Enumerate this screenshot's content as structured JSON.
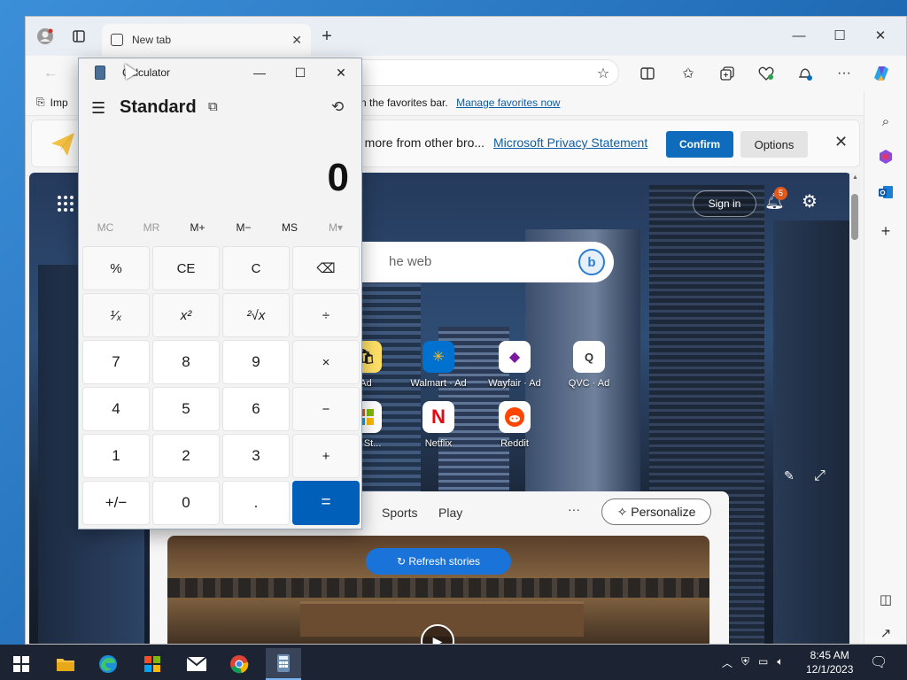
{
  "edge": {
    "tab_label": "New tab",
    "new_tab_icon": "+",
    "favorites_bar": {
      "import_label": "Imp",
      "text": "n the favorites bar.",
      "link": "Manage favorites now"
    },
    "privacy_banner": {
      "text": "d more from other bro...",
      "link": "Microsoft Privacy Statement",
      "confirm": "Confirm",
      "options": "Options"
    },
    "ntp": {
      "sign_in": "Sign in",
      "notification_count": "5",
      "search_placeholder": "he web",
      "tiles": [
        {
          "label": "Ad",
          "icon": "shopping-bag-icon"
        },
        {
          "label": "Walmart · Ad",
          "icon": "walmart-icon"
        },
        {
          "label": "Wayfair · Ad",
          "icon": "wayfair-icon"
        },
        {
          "label": "QVC · Ad",
          "icon": "qvc-icon"
        },
        {
          "label": "oft St...",
          "icon": "microsoft-store-icon"
        },
        {
          "label": "Netflix",
          "icon": "netflix-icon"
        },
        {
          "label": "Reddit",
          "icon": "reddit-icon"
        }
      ],
      "feed": {
        "tabs": [
          "Sports",
          "Play"
        ],
        "more": "···",
        "personalize": "Personalize",
        "refresh": "Refresh stories"
      }
    }
  },
  "calculator": {
    "title": "Calculator",
    "mode": "Standard",
    "display": "0",
    "memory_buttons": [
      {
        "label": "MC",
        "enabled": false
      },
      {
        "label": "MR",
        "enabled": false
      },
      {
        "label": "M+",
        "enabled": true
      },
      {
        "label": "M−",
        "enabled": true
      },
      {
        "label": "MS",
        "enabled": true
      },
      {
        "label": "M▾",
        "enabled": false
      }
    ],
    "keys": [
      "%",
      "CE",
      "C",
      "⌫",
      "¹⁄ₓ",
      "x²",
      "²√x",
      "÷",
      "7",
      "8",
      "9",
      "×",
      "4",
      "5",
      "6",
      "−",
      "1",
      "2",
      "3",
      "+",
      "+/−",
      "0",
      ".",
      "="
    ]
  },
  "taskbar": {
    "time": "8:45 AM",
    "date": "12/1/2023",
    "apps": [
      "file-explorer-icon",
      "edge-icon",
      "store-icon",
      "mail-icon",
      "chrome-icon",
      "calculator-icon"
    ]
  }
}
